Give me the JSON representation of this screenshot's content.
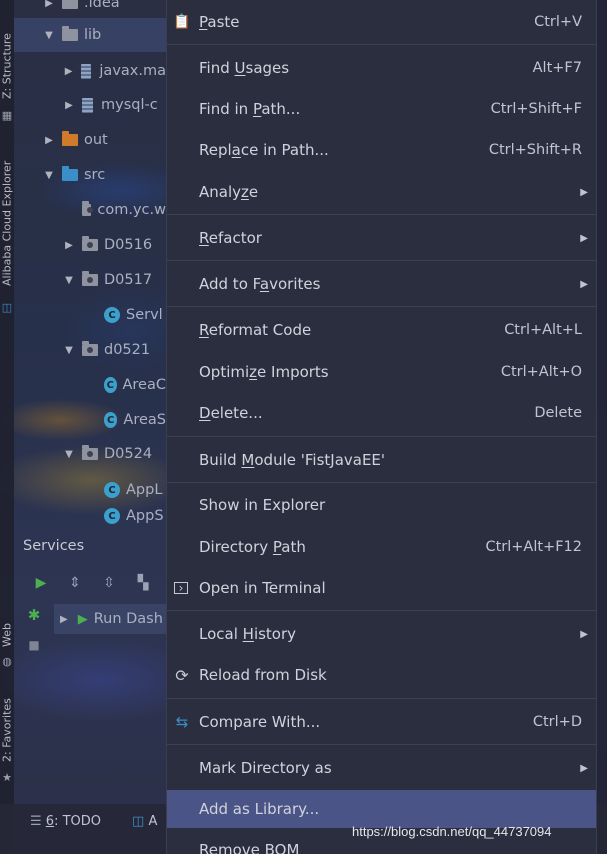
{
  "sidebar_tabs": {
    "structure": "Z: Structure",
    "alibaba": "Alibaba Cloud Explorer",
    "web": "Web",
    "favorites": "2: Favorites"
  },
  "project_tree": [
    {
      "label": ".idea",
      "icon": "folder-icon"
    },
    {
      "label": "lib",
      "icon": "folder-icon"
    },
    {
      "label": "javax.ma",
      "icon": "jar-icon"
    },
    {
      "label": "mysql-c",
      "icon": "jar-icon"
    },
    {
      "label": "out",
      "icon": "folder-orange-icon"
    },
    {
      "label": "src",
      "icon": "folder-blue-icon"
    },
    {
      "label": "com.yc.w",
      "icon": "package-icon"
    },
    {
      "label": "D0516",
      "icon": "package-icon"
    },
    {
      "label": "D0517",
      "icon": "package-icon"
    },
    {
      "label": "Servl",
      "icon": "class-icon"
    },
    {
      "label": "d0521",
      "icon": "package-icon"
    },
    {
      "label": "AreaC",
      "icon": "class-icon"
    },
    {
      "label": "AreaS",
      "icon": "class-icon"
    },
    {
      "label": "D0524",
      "icon": "package-icon"
    },
    {
      "label": "AppL",
      "icon": "class-icon"
    },
    {
      "label": "AppS",
      "icon": "class-icon"
    }
  ],
  "services": {
    "title": "Services",
    "run_item": "Run Dash"
  },
  "bottom_bar": {
    "todo_num": "6",
    "todo_label": ": TODO",
    "second_label": "A"
  },
  "watermark": "https://blog.csdn.net/qq_44737094",
  "context_menu": {
    "items": [
      {
        "label_pre": "",
        "mnemonic": "P",
        "label_post": "aste",
        "shortcut": "Ctrl+V",
        "icon": "clipboard-icon"
      },
      {
        "label_pre": "Find ",
        "mnemonic": "U",
        "label_post": "sages",
        "shortcut": "Alt+F7"
      },
      {
        "label_pre": "Find in ",
        "mnemonic": "P",
        "label_post": "ath...",
        "shortcut": "Ctrl+Shift+F"
      },
      {
        "label_pre": "Repl",
        "mnemonic": "a",
        "label_post": "ce in Path...",
        "shortcut": "Ctrl+Shift+R"
      },
      {
        "label_pre": "Analy",
        "mnemonic": "z",
        "label_post": "e",
        "shortcut": ""
      },
      {
        "label_pre": "",
        "mnemonic": "R",
        "label_post": "efactor",
        "shortcut": ""
      },
      {
        "label_pre": "Add to F",
        "mnemonic": "a",
        "label_post": "vorites",
        "shortcut": ""
      },
      {
        "label_pre": "",
        "mnemonic": "R",
        "label_post": "eformat Code",
        "shortcut": "Ctrl+Alt+L"
      },
      {
        "label_pre": "Optimi",
        "mnemonic": "z",
        "label_post": "e Imports",
        "shortcut": "Ctrl+Alt+O"
      },
      {
        "label_pre": "",
        "mnemonic": "D",
        "label_post": "elete...",
        "shortcut": "Delete"
      },
      {
        "label_pre": "Build ",
        "mnemonic": "M",
        "label_post": "odule 'FistJavaEE'",
        "shortcut": ""
      },
      {
        "label_pre": "Show in Explorer",
        "mnemonic": "",
        "label_post": "",
        "shortcut": ""
      },
      {
        "label_pre": "Directory ",
        "mnemonic": "P",
        "label_post": "ath",
        "shortcut": "Ctrl+Alt+F12"
      },
      {
        "label_pre": "Open in Terminal",
        "mnemonic": "",
        "label_post": "",
        "shortcut": "",
        "icon": "terminal-icon"
      },
      {
        "label_pre": "Local ",
        "mnemonic": "H",
        "label_post": "istory",
        "shortcut": ""
      },
      {
        "label_pre": "Reload from Disk",
        "mnemonic": "",
        "label_post": "",
        "shortcut": "",
        "icon": "reload-icon"
      },
      {
        "label_pre": "Compare With...",
        "mnemonic": "",
        "label_post": "",
        "shortcut": "Ctrl+D",
        "icon": "compare-icon"
      },
      {
        "label_pre": "Mark Directory as",
        "mnemonic": "",
        "label_post": "",
        "shortcut": ""
      },
      {
        "label_pre": "Add as Library...",
        "mnemonic": "",
        "label_post": "",
        "shortcut": ""
      },
      {
        "label_pre": "Remove BOM",
        "mnemonic": "",
        "label_post": "",
        "shortcut": ""
      }
    ],
    "highlighted_item": "Add as Library..."
  },
  "colors": {
    "menu_bg": "#2b2e3f",
    "highlight": "#4b5486",
    "run_green": "#4caf50",
    "class_blue": "#3ca0cc",
    "folder_orange": "#d07a2c"
  }
}
